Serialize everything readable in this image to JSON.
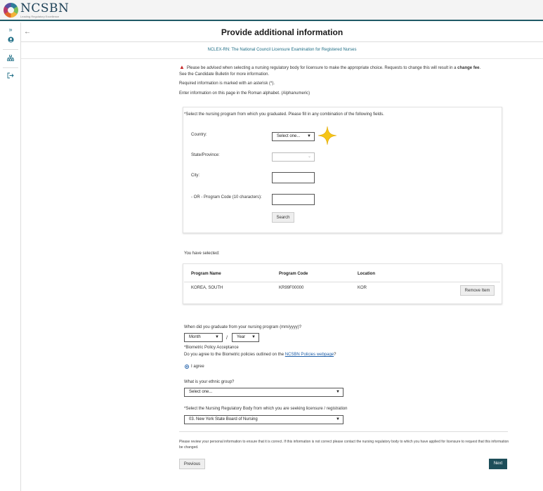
{
  "brand": {
    "name": "NCSBN",
    "tagline": "Leading Regulatory Excellence"
  },
  "sidebar": {
    "icons": [
      "expand-icon",
      "user-icon",
      "org-chart-icon",
      "logout-icon"
    ]
  },
  "page": {
    "title": "Provide additional information",
    "exam": "NCLEX-RN: The National Council Licensure Examination for Registered Nurses"
  },
  "notice": {
    "text_before": "Please be advised when selecting a nursing regulatory body for licensure to make the appropriate choice. Requests to change this will result in a ",
    "bold": "change fee",
    "text_after": ".",
    "line2": "See the Candidate Bulletin for more information."
  },
  "required_note": "Required information is marked with an asterisk (*).",
  "alphabet_note": "Enter information on this page in the Roman alphabet. (Alphanumeric)",
  "program_search": {
    "hint": "*Select the nursing program from which you graduated. Please fill in any combination of the following fields.",
    "country_label": "Country:",
    "country_value": "Select one...",
    "state_label": "State/Province:",
    "state_value": "",
    "city_label": "City:",
    "code_label": "- OR - Program Code (10 characters):",
    "search_button": "Search"
  },
  "selected": {
    "label": "You have selected:",
    "headers": {
      "name": "Program Name",
      "code": "Program Code",
      "location": "Location"
    },
    "row": {
      "name": "KOREA, SOUTH",
      "code": "KR99F00000",
      "location": "KOR",
      "remove": "Remove Item"
    }
  },
  "graduation": {
    "question": "When did you graduate from your nursing program (mm/yyyy)?",
    "month_value": "Month",
    "separator": "/",
    "year_value": "Year"
  },
  "biometric": {
    "title": "*Biometric Policy Acceptance",
    "question_before": "Do you agree to the Biometric policies outlined on the ",
    "link": "NCSBN Policies webpage",
    "question_after": "?",
    "option": "I agree"
  },
  "ethnic": {
    "question": "What is your ethnic group?",
    "value": "Select one..."
  },
  "nrb": {
    "question": "*Select the Nursing Regulatory Body from which you are seeking licensure / registration",
    "value": "03. New York State Board of Nursing"
  },
  "footer_note": "Please review your personal information to ensure that it is correct. If this information is not correct please contact the nursing regulatory body to which you have applied for licensure to request that this information be changed.",
  "buttons": {
    "previous": "Previous",
    "next": "Next"
  },
  "colors": {
    "brand_teal": "#1f5a66",
    "accent": "#1f6e86",
    "next_bg": "#1d4e5a",
    "warning": "#c62828",
    "sparkle": "#f5c518"
  }
}
